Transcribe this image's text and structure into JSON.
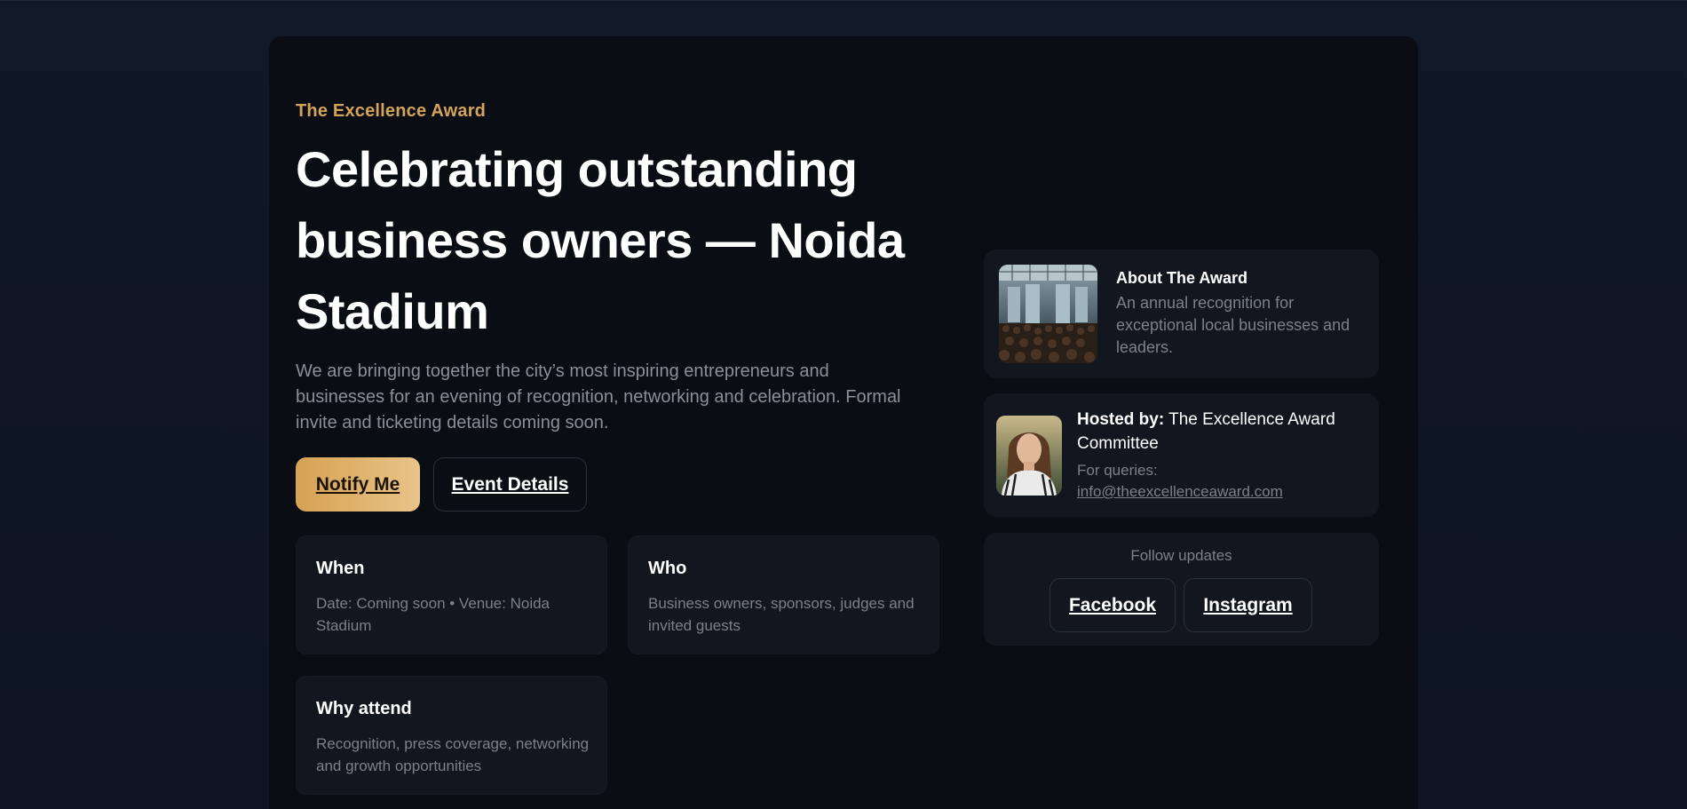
{
  "hero": {
    "eyebrow": "The Excellence Award",
    "headline": "Celebrating outstanding business owners — Noida Stadium",
    "lead": "We are bringing together the city’s most inspiring entrepreneurs and businesses for an evening of recognition, networking and celebration. Formal invite and ticketing details coming soon."
  },
  "buttons": {
    "notify": "Notify Me",
    "details": "Event Details"
  },
  "info_cards": [
    {
      "title": "When",
      "desc": "Date: Coming soon • Venue: Noida Stadium"
    },
    {
      "title": "Who",
      "desc": "Business owners, sponsors, judges and invited guests"
    },
    {
      "title": "Why attend",
      "desc": "Recognition, press coverage, networking and growth opportunities"
    }
  ],
  "about": {
    "title": "About The Award",
    "desc": "An annual recognition for exceptional local businesses and leaders."
  },
  "host": {
    "label": "Hosted by:",
    "name": "The Excellence Award Committee",
    "query_label": "For queries:",
    "email": "info@theexcellenceaward.com"
  },
  "follow": {
    "label": "Follow updates",
    "facebook": "Facebook",
    "instagram": "Instagram"
  },
  "colors": {
    "accent": "#d4a45a",
    "background": "#0f1522",
    "card": "#12161e"
  }
}
